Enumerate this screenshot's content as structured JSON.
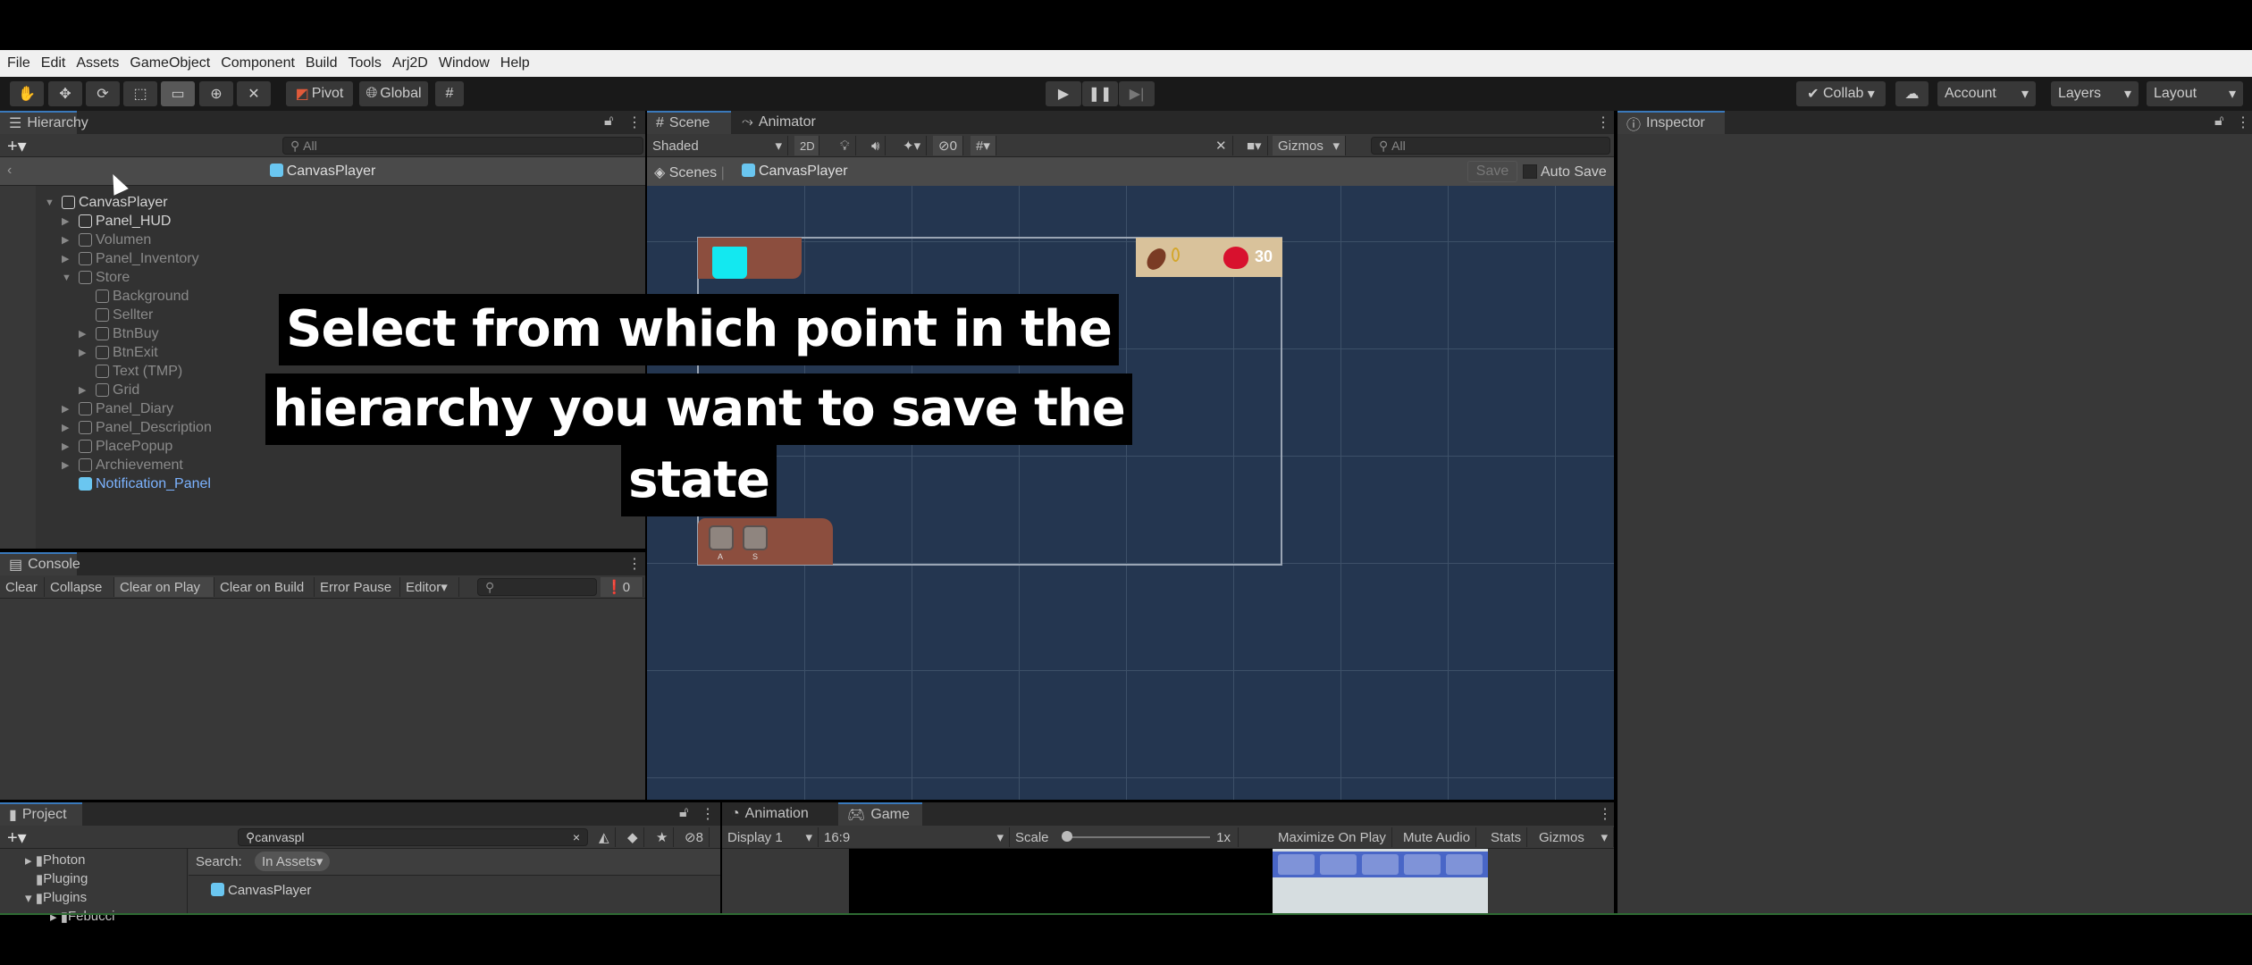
{
  "menu": [
    "File",
    "Edit",
    "Assets",
    "GameObject",
    "Component",
    "Build",
    "Tools",
    "Arj2D",
    "Window",
    "Help"
  ],
  "toolbar": {
    "tools": [
      "hand-icon",
      "move-icon",
      "rotate-icon",
      "scale-icon",
      "rect-tool-icon",
      "transform-icon",
      "custom-tool-icon"
    ],
    "active_tool": "rect-tool-icon",
    "pivot": "Pivot",
    "global": "Global",
    "collab": "Collab",
    "account": "Account",
    "layers": "Layers",
    "layout": "Layout"
  },
  "hierarchy": {
    "tab": "Hierarchy",
    "search_placeholder": "All",
    "breadcrumb": "CanvasPlayer",
    "items": [
      {
        "label": "CanvasPlayer",
        "level": 0,
        "expander": "expanded",
        "state": "normal"
      },
      {
        "label": "Panel_HUD",
        "level": 1,
        "expander": "collapsed",
        "state": "normal"
      },
      {
        "label": "Volumen",
        "level": 1,
        "expander": "collapsed",
        "state": "inactive"
      },
      {
        "label": "Panel_Inventory",
        "level": 1,
        "expander": "collapsed",
        "state": "inactive"
      },
      {
        "label": "Store",
        "level": 1,
        "expander": "expanded",
        "state": "inactive"
      },
      {
        "label": "Background",
        "level": 2,
        "expander": "none",
        "state": "inactive"
      },
      {
        "label": "Sellter",
        "level": 2,
        "expander": "none",
        "state": "inactive"
      },
      {
        "label": "BtnBuy",
        "level": 2,
        "expander": "collapsed",
        "state": "inactive"
      },
      {
        "label": "BtnExit",
        "level": 2,
        "expander": "collapsed",
        "state": "inactive"
      },
      {
        "label": "Text (TMP)",
        "level": 2,
        "expander": "none",
        "state": "inactive"
      },
      {
        "label": "Grid",
        "level": 2,
        "expander": "collapsed",
        "state": "inactive"
      },
      {
        "label": "Panel_Diary",
        "level": 1,
        "expander": "collapsed",
        "state": "inactive"
      },
      {
        "label": "Panel_Description",
        "level": 1,
        "expander": "collapsed",
        "state": "inactive"
      },
      {
        "label": "PlacePopup",
        "level": 1,
        "expander": "collapsed",
        "state": "inactive"
      },
      {
        "label": "Archievement",
        "level": 1,
        "expander": "collapsed",
        "state": "inactive"
      },
      {
        "label": "Notification_Panel",
        "level": 1,
        "expander": "none",
        "state": "prefab"
      }
    ]
  },
  "scene": {
    "tabs": [
      "Scene",
      "Animator"
    ],
    "shading": "Shaded",
    "mode_2d": "2D",
    "hidden_count": "0",
    "gizmos": "Gizmos",
    "search_placeholder": "All",
    "breadcrumb_root": "Scenes",
    "breadcrumb_current": "CanvasPlayer",
    "save": "Save",
    "auto_save": "Auto Save",
    "hud_health": "30",
    "hud_coins": "0",
    "key_labels": [
      "A",
      "S"
    ]
  },
  "caption": [
    "Select from which point in the",
    "hierarchy you want to save the",
    "state"
  ],
  "inspector": {
    "tab": "Inspector"
  },
  "console": {
    "tab": "Console",
    "buttons": [
      "Clear",
      "Collapse",
      "Clear on Play",
      "Clear on Build",
      "Error Pause",
      "Editor"
    ],
    "active": [
      "Clear on Play"
    ],
    "error_count": "0"
  },
  "project": {
    "tab": "Project",
    "search_value": "canvaspl",
    "hidden_count": "8",
    "folders": [
      "Photon",
      "Pluging",
      "Plugins",
      "Febucci"
    ],
    "search_label": "Search:",
    "search_scope": "In Assets",
    "results": [
      "CanvasPlayer"
    ]
  },
  "game": {
    "tabs": [
      "Animation",
      "Game"
    ],
    "display": "Display 1",
    "aspect": "16:9",
    "scale_label": "Scale",
    "scale_value": "1x",
    "maximize": "Maximize On Play",
    "mute": "Mute Audio",
    "stats": "Stats",
    "gizmos": "Gizmos"
  },
  "colors": {
    "scene_bg": "#243650",
    "panel_bg": "#383838",
    "accent": "#3a79bb",
    "prefab_blue": "#7cb3ff"
  }
}
